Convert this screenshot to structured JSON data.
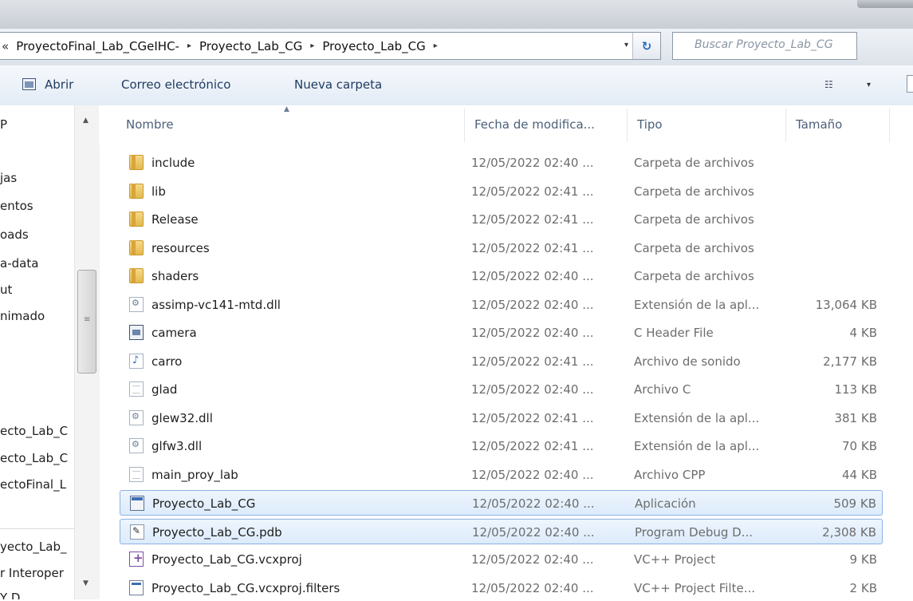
{
  "address": {
    "prefix": "«",
    "crumbs": [
      "ProyectoFinal_Lab_CGeIHC-",
      "Proyecto_Lab_CG",
      "Proyecto_Lab_CG"
    ],
    "separator": "▸",
    "dropdown": "▾",
    "refresh": "↻"
  },
  "search": {
    "placeholder": "Buscar Proyecto_Lab_CG"
  },
  "toolbar": {
    "open_label": "Abrir",
    "email_label": "Correo electrónico",
    "new_folder_label": "Nueva carpeta",
    "view_icon": "☷",
    "view_dropdown": "▾"
  },
  "nav": {
    "items": [
      "P",
      "jas",
      "entos",
      "oads",
      "a-data",
      "ut",
      "nimado",
      "ecto_Lab_C",
      "ecto_Lab_C",
      "ectoFinal_L",
      "yecto_Lab_",
      "r Interoper",
      "Y D..."
    ],
    "scroll_up": "▲",
    "scroll_down": "▼",
    "grip": "≡"
  },
  "columns": {
    "name": "Nombre",
    "date": "Fecha de modifica...",
    "type": "Tipo",
    "size": "Tamaño",
    "sort_indicator": "▲"
  },
  "files": [
    {
      "name": "include",
      "date": "12/05/2022 02:40 ...",
      "type": "Carpeta de archivos",
      "size": "",
      "icon": "folder-icon",
      "kind": "folder",
      "selected": false
    },
    {
      "name": "lib",
      "date": "12/05/2022 02:41 ...",
      "type": "Carpeta de archivos",
      "size": "",
      "icon": "folder-icon",
      "kind": "folder",
      "selected": false
    },
    {
      "name": "Release",
      "date": "12/05/2022 02:41 ...",
      "type": "Carpeta de archivos",
      "size": "",
      "icon": "folder-icon",
      "kind": "folder",
      "selected": false
    },
    {
      "name": "resources",
      "date": "12/05/2022 02:41 ...",
      "type": "Carpeta de archivos",
      "size": "",
      "icon": "folder-icon",
      "kind": "folder",
      "selected": false
    },
    {
      "name": "shaders",
      "date": "12/05/2022 02:40 ...",
      "type": "Carpeta de archivos",
      "size": "",
      "icon": "folder-icon",
      "kind": "folder",
      "selected": false
    },
    {
      "name": "assimp-vc141-mtd.dll",
      "date": "12/05/2022 02:40 ...",
      "type": "Extensión de la apl...",
      "size": "13,064 KB",
      "icon": "dll-file-icon",
      "kind": "dll",
      "selected": false
    },
    {
      "name": "camera",
      "date": "12/05/2022 02:40 ...",
      "type": "C Header File",
      "size": "4 KB",
      "icon": "header-file-icon",
      "kind": "header",
      "selected": false
    },
    {
      "name": "carro",
      "date": "12/05/2022 02:41 ...",
      "type": "Archivo de sonido",
      "size": "2,177 KB",
      "icon": "sound-file-icon",
      "kind": "sound",
      "selected": false
    },
    {
      "name": "glad",
      "date": "12/05/2022 02:40 ...",
      "type": "Archivo C",
      "size": "113 KB",
      "icon": "text-file-icon",
      "kind": "text",
      "selected": false
    },
    {
      "name": "glew32.dll",
      "date": "12/05/2022 02:41 ...",
      "type": "Extensión de la apl...",
      "size": "381 KB",
      "icon": "dll-file-icon",
      "kind": "dll",
      "selected": false
    },
    {
      "name": "glfw3.dll",
      "date": "12/05/2022 02:41 ...",
      "type": "Extensión de la apl...",
      "size": "70 KB",
      "icon": "dll-file-icon",
      "kind": "dll",
      "selected": false
    },
    {
      "name": "main_proy_lab",
      "date": "12/05/2022 02:40 ...",
      "type": "Archivo CPP",
      "size": "44 KB",
      "icon": "text-file-icon",
      "kind": "text",
      "selected": false
    },
    {
      "name": "Proyecto_Lab_CG",
      "date": "12/05/2022 02:40 ...",
      "type": "Aplicación",
      "size": "509 KB",
      "icon": "application-icon",
      "kind": "app",
      "selected": true
    },
    {
      "name": "Proyecto_Lab_CG.pdb",
      "date": "12/05/2022 02:40 ...",
      "type": "Program Debug D...",
      "size": "2,308 KB",
      "icon": "pdb-file-icon",
      "kind": "pdb",
      "selected": true
    },
    {
      "name": "Proyecto_Lab_CG.vcxproj",
      "date": "12/05/2022 02:40 ...",
      "type": "VC++ Project",
      "size": "9 KB",
      "icon": "vcxproj-file-icon",
      "kind": "vcx",
      "selected": false
    },
    {
      "name": "Proyecto_Lab_CG.vcxproj.filters",
      "date": "12/05/2022 02:40 ...",
      "type": "VC++ Project Filte...",
      "size": "2 KB",
      "icon": "filters-file-icon",
      "kind": "filters",
      "selected": false
    }
  ],
  "colors": {
    "selection_bg": "#dcebfc",
    "selection_border": "#8cb2e3",
    "header_text": "#4c607a",
    "detail_text": "#6d6d6d"
  }
}
